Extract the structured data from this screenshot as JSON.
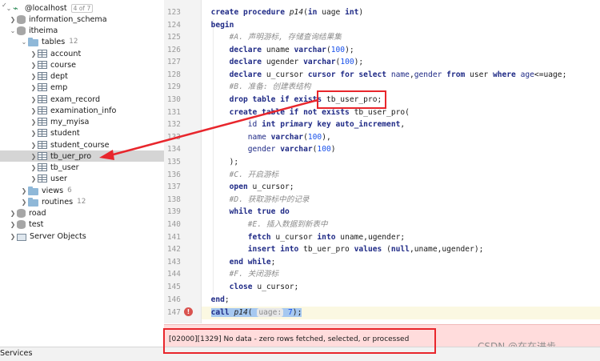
{
  "tree": {
    "host": {
      "label": "@localhost",
      "badge": "4 of 7"
    },
    "items": [
      {
        "label": "information_schema",
        "count": "",
        "kind": "db"
      },
      {
        "label": "itheima",
        "count": "",
        "kind": "db"
      },
      {
        "label": "tables",
        "count": "12",
        "kind": "folder"
      },
      {
        "label": "account",
        "kind": "table"
      },
      {
        "label": "course",
        "kind": "table"
      },
      {
        "label": "dept",
        "kind": "table"
      },
      {
        "label": "emp",
        "kind": "table"
      },
      {
        "label": "exam_record",
        "kind": "table"
      },
      {
        "label": "examination_info",
        "kind": "table"
      },
      {
        "label": "my_myisa",
        "kind": "table"
      },
      {
        "label": "student",
        "kind": "table"
      },
      {
        "label": "student_course",
        "kind": "table"
      },
      {
        "label": "tb_uer_pro",
        "kind": "table"
      },
      {
        "label": "tb_user",
        "kind": "table"
      },
      {
        "label": "user",
        "kind": "table"
      },
      {
        "label": "views",
        "count": "6",
        "kind": "folder"
      },
      {
        "label": "routines",
        "count": "12",
        "kind": "folder"
      },
      {
        "label": "road",
        "count": "",
        "kind": "db"
      },
      {
        "label": "test",
        "count": "",
        "kind": "db"
      },
      {
        "label": "Server Objects",
        "count": "",
        "kind": "server"
      }
    ]
  },
  "editor": {
    "line_numbers": [
      "123",
      "124",
      "125",
      "126",
      "127",
      "128",
      "129",
      "130",
      "131",
      "132",
      "133",
      "134",
      "135",
      "136",
      "137",
      "138",
      "139",
      "140",
      "141",
      "142",
      "143",
      "144",
      "145",
      "146",
      "147"
    ],
    "lines": {
      "l124": {
        "k1": "create procedure ",
        "fn": "p14",
        "p1": "(",
        "k2": "in ",
        "p2": "uage ",
        "k3": "int",
        "p3": ")"
      },
      "l125": {
        "k1": "begin"
      },
      "l126": {
        "c": "#A. 声明游标, 存储查询结果集"
      },
      "l127": {
        "k1": "declare ",
        "p1": "uname ",
        "k2": "varchar",
        "p2": "(",
        "n": "100",
        "p3": ");"
      },
      "l128": {
        "k1": "declare ",
        "p1": "ugender ",
        "k2": "varchar",
        "p2": "(",
        "n": "100",
        "p3": ");"
      },
      "l129": {
        "k1": "declare ",
        "p1": "u_cursor ",
        "k2": "cursor for select ",
        "p2": "name",
        "p3": ",",
        "p4": "gender ",
        "k3": "from ",
        "p5": "user ",
        "k4": "where ",
        "p6": "age",
        "p7": "<=uage;"
      },
      "l130": {
        "c": "#B. 准备: 创建表结构"
      },
      "l131": {
        "k1": "drop table if exists ",
        "p1": "tb_user_pro;"
      },
      "l132": {
        "k1": "create table if not exists ",
        "p1": "tb_user_pro("
      },
      "l133": {
        "p1": "id ",
        "k1": "int primary key auto_increment",
        "p2": ","
      },
      "l134": {
        "k1": "name ",
        "k2": "varchar",
        "p1": "(",
        "n": "100",
        "p2": "),"
      },
      "l135": {
        "k1": "gender ",
        "k2": "varchar",
        "p1": "(",
        "n": "100",
        "p2": ")"
      },
      "l136": {
        "p1": ");"
      },
      "l137": {
        "c": "#C. 开启游标"
      },
      "l138": {
        "k1": "open ",
        "p1": "u_cursor;"
      },
      "l139": {
        "c": "#D. 获取游标中的记录"
      },
      "l140": {
        "k1": "while true do"
      },
      "l141": {
        "c": "#E. 插入数据到新表中"
      },
      "l142": {
        "k1": "fetch ",
        "p1": "u_cursor ",
        "k2": "into ",
        "p2": "uname,ugender;"
      },
      "l143": {
        "k1": "insert into ",
        "p1": "tb_uer_pro ",
        "k2": "values ",
        "p2": "(",
        "k3": "null",
        "p3": ",uname,ugender);"
      },
      "l144": {
        "k1": "end while",
        "p1": ";"
      },
      "l145": {
        "c": "#F. 关闭游标"
      },
      "l146": {
        "k1": "close ",
        "p1": "u_cursor;"
      },
      "l147": {
        "k1": "end",
        "p1": ";"
      },
      "l148": {
        "k1": "call ",
        "fn": "p14",
        "p1": "( ",
        "hint": "uage:",
        "n": " 7",
        "p2": ");"
      }
    }
  },
  "error_message": "[02000][1329] No data - zero rows fetched, selected, or processed",
  "status_bar": {
    "tab": "Services"
  },
  "watermark": "CSDN @在在进步",
  "colors": {
    "annotation_red": "#e8262c",
    "error_bg": "#ffdcdc",
    "selection": "#a6c8f0"
  }
}
